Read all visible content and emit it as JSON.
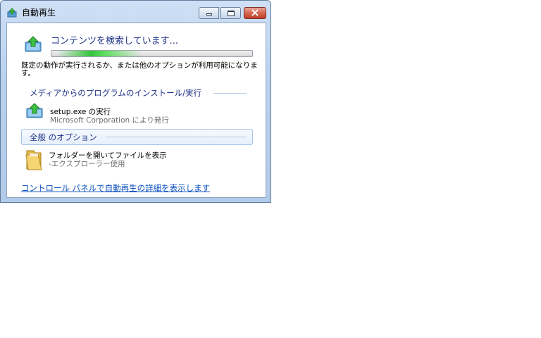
{
  "window": {
    "title": "自動再生",
    "icon": "autoplay-icon",
    "controls": {
      "minimize": "minimize-icon",
      "maximize": "maximize-icon",
      "close": "close-icon"
    }
  },
  "status": {
    "heading": "コンテンツを検索しています...",
    "icon": "autoplay-search-icon",
    "progress_indeterminate": true,
    "description": "既定の動作が実行されるか、または他のオプションが利用可能になります。"
  },
  "sections": [
    {
      "heading": "メディアからのプログラムのインストール/実行",
      "options": [
        {
          "title": "setup.exe の実行",
          "subtitle": "Microsoft Corporation により発行",
          "icon": "install-arrow-icon"
        }
      ]
    },
    {
      "heading": "全般 のオプション",
      "options": [
        {
          "title": "フォルダーを開いてファイルを表示",
          "subtitle": "-エクスプローラー使用",
          "icon": "folder-icon"
        }
      ]
    }
  ],
  "footer": {
    "link": "コントロール パネルで自動再生の詳細を表示します"
  },
  "colors": {
    "heading": "#1e3287",
    "link": "#0b4fbf",
    "progress": "#34c53b",
    "close_button": "#c0402a"
  }
}
